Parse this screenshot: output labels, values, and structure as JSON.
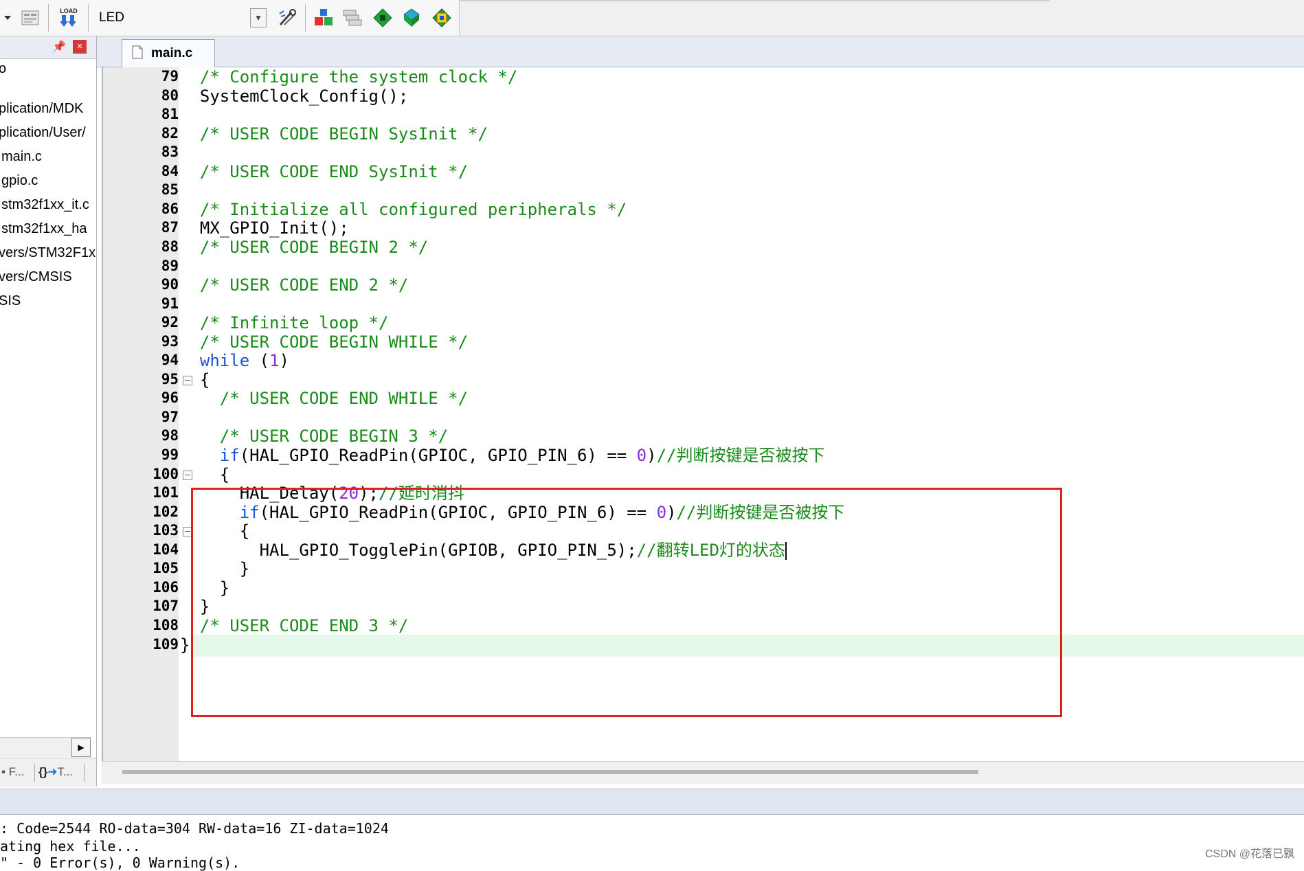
{
  "toolbar": {
    "target": "LED",
    "load_label": "LOAD",
    "icons": [
      "dropdown-arrow-icon",
      "options-dialog-icon",
      "download-load-icon",
      "target-options-icon",
      "manage-components-icon",
      "multi-project-icon",
      "pack-installer-icon",
      "select-software-packs-icon",
      "run-time-environment-icon"
    ]
  },
  "project_panel": {
    "tree": [
      "o",
      "plication/MDK",
      "plication/User/",
      "main.c",
      "gpio.c",
      "stm32f1xx_it.c",
      "stm32f1xx_ha",
      "vers/STM32F1x",
      "vers/CMSIS",
      "SIS"
    ],
    "tabs": [
      "F...",
      "T..."
    ]
  },
  "editor": {
    "tab": "main.c",
    "lines": [
      {
        "n": "79",
        "parts": [
          {
            "t": "  "
          },
          {
            "t": "/* Configure the system clock */",
            "c": "cm"
          }
        ]
      },
      {
        "n": "80",
        "parts": [
          {
            "t": "  SystemClock_Config();"
          }
        ]
      },
      {
        "n": "81",
        "parts": []
      },
      {
        "n": "82",
        "parts": [
          {
            "t": "  "
          },
          {
            "t": "/* USER CODE BEGIN SysInit */",
            "c": "cm"
          }
        ]
      },
      {
        "n": "83",
        "parts": []
      },
      {
        "n": "84",
        "parts": [
          {
            "t": "  "
          },
          {
            "t": "/* USER CODE END SysInit */",
            "c": "cm"
          }
        ]
      },
      {
        "n": "85",
        "parts": []
      },
      {
        "n": "86",
        "parts": [
          {
            "t": "  "
          },
          {
            "t": "/* Initialize all configured peripherals */",
            "c": "cm"
          }
        ]
      },
      {
        "n": "87",
        "parts": [
          {
            "t": "  MX_GPIO_Init();"
          }
        ]
      },
      {
        "n": "88",
        "parts": [
          {
            "t": "  "
          },
          {
            "t": "/* USER CODE BEGIN 2 */",
            "c": "cm"
          }
        ]
      },
      {
        "n": "89",
        "parts": []
      },
      {
        "n": "90",
        "parts": [
          {
            "t": "  "
          },
          {
            "t": "/* USER CODE END 2 */",
            "c": "cm"
          }
        ]
      },
      {
        "n": "91",
        "parts": []
      },
      {
        "n": "92",
        "parts": [
          {
            "t": "  "
          },
          {
            "t": "/* Infinite loop */",
            "c": "cm"
          }
        ]
      },
      {
        "n": "93",
        "parts": [
          {
            "t": "  "
          },
          {
            "t": "/* USER CODE BEGIN WHILE */",
            "c": "cm"
          }
        ]
      },
      {
        "n": "94",
        "parts": [
          {
            "t": "  "
          },
          {
            "t": "while",
            "c": "kw"
          },
          {
            "t": " ("
          },
          {
            "t": "1",
            "c": "num"
          },
          {
            "t": ")"
          }
        ]
      },
      {
        "n": "95",
        "fold": true,
        "parts": [
          {
            "t": "  {"
          }
        ]
      },
      {
        "n": "96",
        "parts": [
          {
            "t": "    "
          },
          {
            "t": "/* USER CODE END WHILE */",
            "c": "cm"
          }
        ]
      },
      {
        "n": "97",
        "parts": []
      },
      {
        "n": "98",
        "parts": [
          {
            "t": "    "
          },
          {
            "t": "/* USER CODE BEGIN 3 */",
            "c": "cm"
          }
        ]
      },
      {
        "n": "99",
        "parts": [
          {
            "t": "    "
          },
          {
            "t": "if",
            "c": "kw"
          },
          {
            "t": "(HAL_GPIO_ReadPin(GPIOC, GPIO_PIN_6) == "
          },
          {
            "t": "0",
            "c": "num"
          },
          {
            "t": ")"
          },
          {
            "t": "//判断按键是否被按下",
            "c": "cm"
          }
        ]
      },
      {
        "n": "100",
        "fold": true,
        "parts": [
          {
            "t": "    {"
          }
        ]
      },
      {
        "n": "101",
        "parts": [
          {
            "t": "      HAL_Delay("
          },
          {
            "t": "20",
            "c": "num"
          },
          {
            "t": ");"
          },
          {
            "t": "//延时消抖",
            "c": "cm"
          }
        ]
      },
      {
        "n": "102",
        "parts": [
          {
            "t": "      "
          },
          {
            "t": "if",
            "c": "kw"
          },
          {
            "t": "(HAL_GPIO_ReadPin(GPIOC, GPIO_PIN_6) == "
          },
          {
            "t": "0",
            "c": "num"
          },
          {
            "t": ")"
          },
          {
            "t": "//判断按键是否被按下",
            "c": "cm"
          }
        ]
      },
      {
        "n": "103",
        "fold": true,
        "parts": [
          {
            "t": "      {"
          }
        ]
      },
      {
        "n": "104",
        "current": true,
        "parts": [
          {
            "t": "        HAL_GPIO_TogglePin(GPIOB, GPIO_PIN_5);"
          },
          {
            "t": "//翻转LED灯的状态",
            "c": "cm"
          }
        ]
      },
      {
        "n": "105",
        "parts": [
          {
            "t": "      }"
          }
        ]
      },
      {
        "n": "106",
        "parts": [
          {
            "t": "    }"
          }
        ]
      },
      {
        "n": "107",
        "parts": [
          {
            "t": "  }"
          }
        ]
      },
      {
        "n": "108",
        "parts": [
          {
            "t": "  "
          },
          {
            "t": "/* USER CODE END 3 */",
            "c": "cm"
          }
        ]
      },
      {
        "n": "109",
        "parts": [
          {
            "t": "}"
          }
        ]
      }
    ]
  },
  "build_output": {
    "lines": [
      ": Code=2544 RO-data=304 RW-data=16 ZI-data=1024",
      "ating hex file...",
      "\" - 0 Error(s), 0 Warning(s)."
    ]
  },
  "watermark": "CSDN @花落已飘",
  "colors": {
    "comment": "#1a8a1a",
    "keyword": "#1a55d6",
    "number": "#8a2be2",
    "highlight_box": "#e02020",
    "current_line": "#e6f8e9"
  }
}
